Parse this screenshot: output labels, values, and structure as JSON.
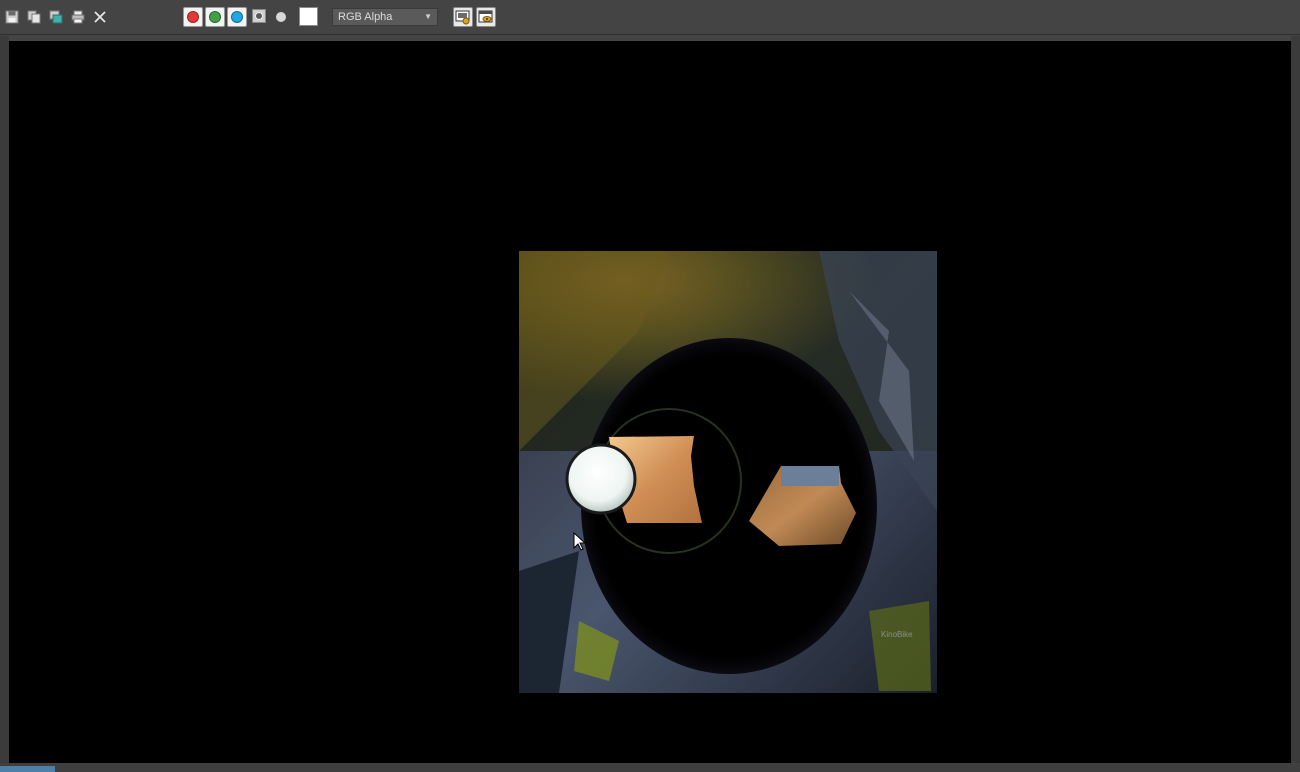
{
  "toolbar": {
    "icons": [
      "save-icon",
      "clone-icon",
      "copy-icon",
      "print-icon",
      "close-icon"
    ],
    "channels": {
      "red": "#e53935",
      "green": "#43a047",
      "blue": "#1ea7e0"
    },
    "channel_display": {
      "selected": "RGB Alpha"
    },
    "display_buttons": [
      "toggle-ui-overlay-icon",
      "display-settings-icon"
    ]
  },
  "viewport": {
    "background": "#000000",
    "render_watermark": "KinoBike"
  }
}
